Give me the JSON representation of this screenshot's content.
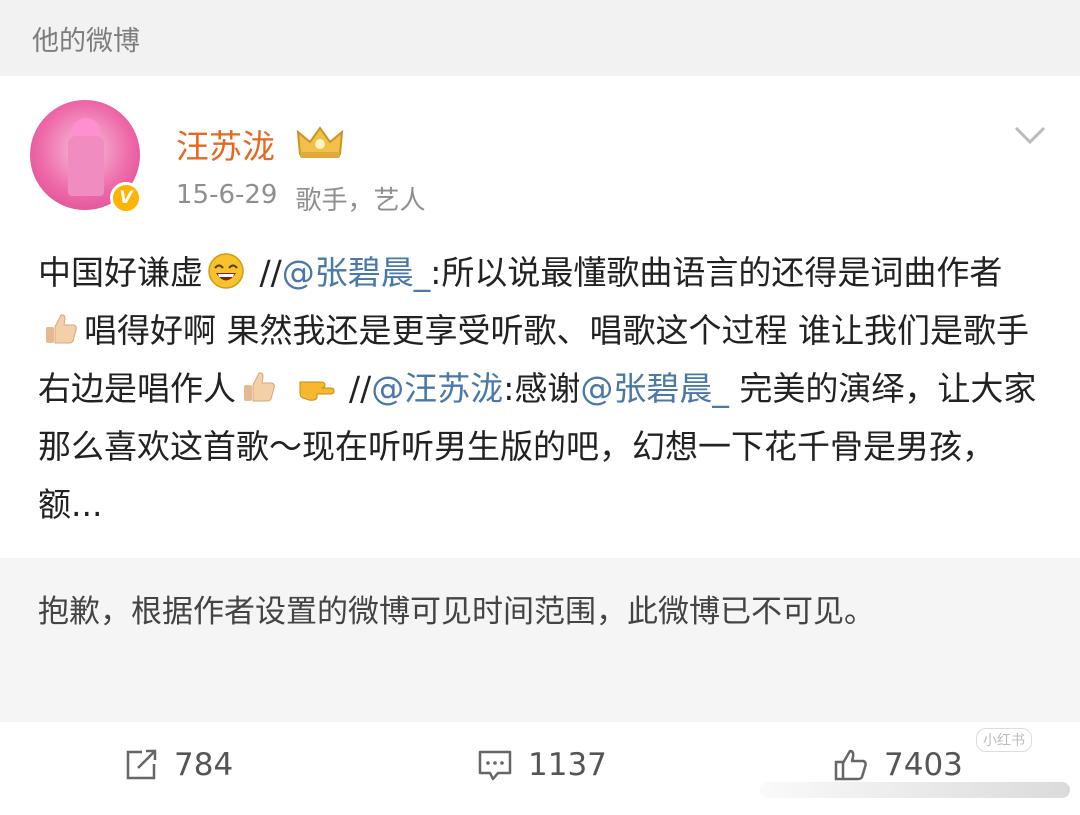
{
  "section_title": "他的微博",
  "user": {
    "name": "汪苏泷",
    "verified_badge": "V",
    "date": "15-6-29",
    "description": "歌手，艺人"
  },
  "post": {
    "segments": {
      "t1": "中国好谦虚",
      "t2": " //",
      "m1": "@张碧晨_",
      "t3": ":所以说最懂歌曲语言的还得是词曲作者",
      "t4": "唱得好啊 果然我还是更享受听歌、唱歌这个过程 谁让我们是歌手 右边是唱作人",
      "t5": " //",
      "m2": "@汪苏泷",
      "t6": ":感谢",
      "m3": "@张碧晨_",
      "t7": " 完美的演绎，让大家那么喜欢这首歌～现在听听男生版的吧，幻想一下花千骨是男孩，额..."
    },
    "emojis": [
      "laughing-emoji",
      "thumbs-up-emoji",
      "thumbs-up-emoji",
      "pointing-right-emoji"
    ]
  },
  "notice": "抱歉，根据作者设置的微博可见时间范围，此微博已不可见。",
  "actions": {
    "repost_count": "784",
    "comment_count": "1137",
    "like_count": "7403"
  },
  "watermark": "小红书",
  "colors": {
    "username": "#e8671c",
    "mention": "#4a78a8",
    "header_bg": "#f2f2f2",
    "notice_bg": "#f5f5f5"
  }
}
